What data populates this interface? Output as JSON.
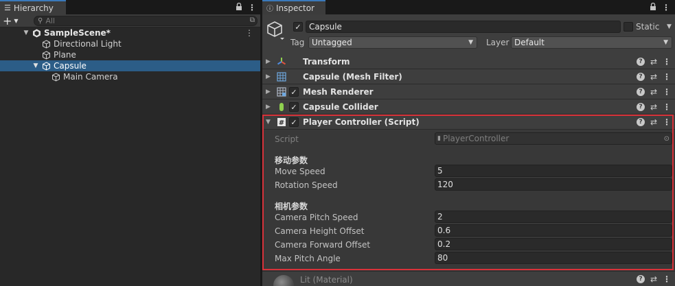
{
  "hierarchy": {
    "tab_label": "Hierarchy",
    "search_placeholder": "All",
    "scene_name": "SampleScene*",
    "items": [
      {
        "label": "Directional Light"
      },
      {
        "label": "Plane"
      },
      {
        "label": "Capsule"
      },
      {
        "label": "Main Camera"
      }
    ]
  },
  "inspector": {
    "tab_label": "Inspector",
    "object_name": "Capsule",
    "static_label": "Static",
    "tag_label": "Tag",
    "tag_value": "Untagged",
    "layer_label": "Layer",
    "layer_value": "Default",
    "components": [
      {
        "name": "Transform"
      },
      {
        "name": "Capsule (Mesh Filter)"
      },
      {
        "name": "Mesh Renderer"
      },
      {
        "name": "Capsule Collider"
      },
      {
        "name": "Player Controller (Script)"
      }
    ],
    "script_label": "Script",
    "script_value": "PlayerController",
    "section_move": "移动参数",
    "section_camera": "相机参数",
    "props": [
      {
        "label": "Move Speed",
        "value": "5"
      },
      {
        "label": "Rotation Speed",
        "value": "120"
      },
      {
        "label": "Camera Pitch Speed",
        "value": "2"
      },
      {
        "label": "Camera Height Offset",
        "value": "0.6"
      },
      {
        "label": "Camera Forward Offset",
        "value": "0.2"
      },
      {
        "label": "Max Pitch Angle",
        "value": "80"
      }
    ],
    "material_label": "Lit (Material)"
  },
  "colors": {
    "selection": "#2c5d87",
    "tab_accent": "#3a79bb",
    "highlight_border": "#d9323a"
  },
  "icons": [
    "hierarchy-list-icon",
    "lock-icon",
    "kebab-menu-icon",
    "plus-icon",
    "search-icon",
    "unity-scene-icon",
    "gameobject-cube-icon",
    "transform-icon",
    "mesh-filter-icon",
    "mesh-renderer-icon",
    "capsule-collider-icon",
    "script-icon",
    "help-icon",
    "preset-icon",
    "object-picker-icon",
    "info-icon"
  ]
}
